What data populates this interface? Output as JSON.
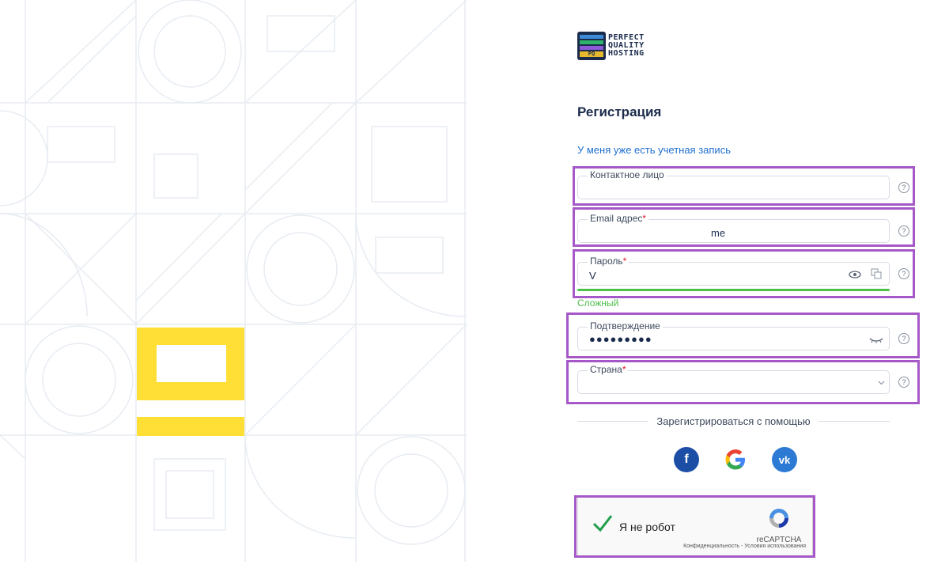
{
  "logo": {
    "line1": "PERFECT",
    "line2": "QUALITY",
    "line3": "HOSTING",
    "mark_text": "PQ"
  },
  "form": {
    "title": "Регистрация",
    "login_link": "У меня уже есть учетная запись",
    "contact": {
      "label": "Контактное лицо",
      "value": ""
    },
    "email": {
      "label": "Email адрес",
      "required": "*",
      "value": "me"
    },
    "password": {
      "label": "Пароль",
      "required": "*",
      "value": "V"
    },
    "strength": "Сложный",
    "confirm": {
      "label": "Подтверждение",
      "value": "●●●●●●●●●"
    },
    "country": {
      "label": "Страна",
      "required": "*",
      "value": ""
    },
    "help_symbol": "?"
  },
  "social": {
    "heading": "Зарегистрироваться с помощью",
    "facebook": "f",
    "google": "G",
    "vk": "vk"
  },
  "recaptcha": {
    "label": "Я не робот",
    "brand": "reCAPTCHA",
    "terms": "Конфиденциальность - Условия использования"
  },
  "colors": {
    "accent_yellow": "#FFDE35",
    "highlight": "#a658c8",
    "link": "#1f6fd1",
    "strength": "#4fc04b",
    "required": "#e0192e"
  }
}
